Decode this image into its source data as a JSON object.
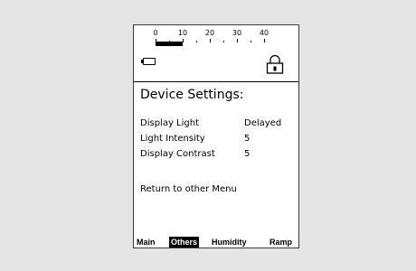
{
  "scale": {
    "labels": [
      "0",
      "10",
      "20",
      "30",
      "40"
    ],
    "level": 10
  },
  "title": "Device Settings:",
  "settings": [
    {
      "label": "Display Light",
      "value": "Delayed"
    },
    {
      "label": "Light Intensity",
      "value": "5"
    },
    {
      "label": "Display Contrast",
      "value": "5"
    }
  ],
  "return_link": "Return to other Menu",
  "tabs": [
    {
      "label": "Main",
      "active": false
    },
    {
      "label": "Others",
      "active": true
    },
    {
      "label": "Humidity",
      "active": false
    },
    {
      "label": "Ramp",
      "active": false
    }
  ],
  "icons": {
    "battery": "battery-icon",
    "lock": "lock-icon"
  }
}
